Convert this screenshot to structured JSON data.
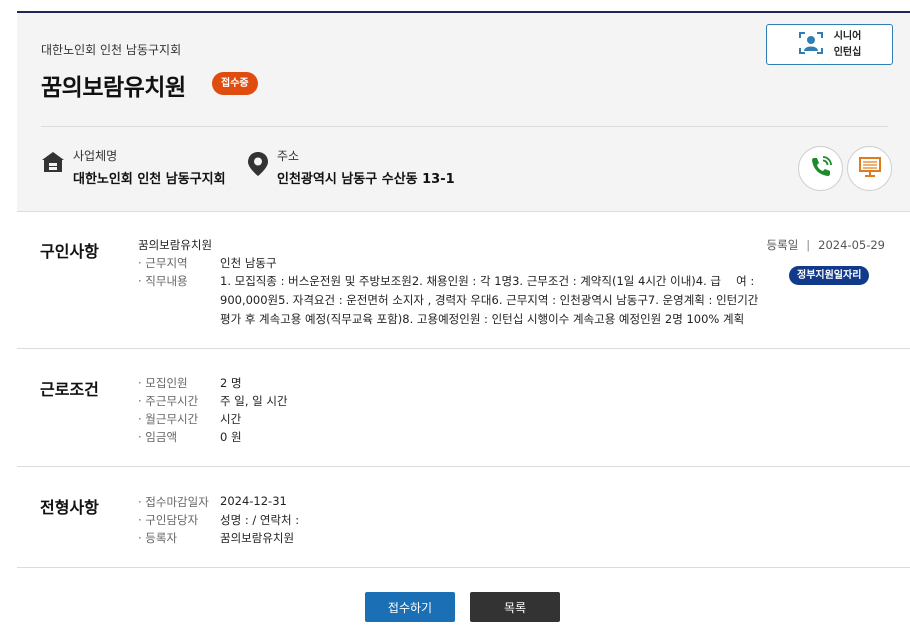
{
  "header": {
    "org_sub": "대한노인회 인천 남동구지회",
    "title": "꿈의보람유치원",
    "status_badge": "접수중",
    "senior_button": {
      "line1": "시니어",
      "line2": "인턴십"
    },
    "business": {
      "label": "사업체명",
      "value": "대한노인회 인천 남동구지회",
      "icon": "building-icon"
    },
    "address": {
      "label": "주소",
      "value": "인천광역시 남동구 수산동 13-1",
      "icon": "location-pin-icon"
    },
    "actions": [
      {
        "name": "phone-icon",
        "color": "#1e8a2e"
      },
      {
        "name": "monitor-icon",
        "color": "#e07b1a"
      }
    ]
  },
  "recruit": {
    "title": "구인사항",
    "post_name": "꿈의보람유치원",
    "reg_label": "등록일",
    "reg_sep": "|",
    "reg_date": "2024-05-29",
    "badge": "정부지원일자리",
    "rows": [
      {
        "key": "· 근무지역",
        "value": "인천 남동구"
      },
      {
        "key": "· 직무내용",
        "value": ""
      }
    ],
    "duty_lines": [
      "1. 모집직종 : 버스운전원 및 주방보조원2. 채용인원 : 각 1명3. 근무조건 : 계약직(1일 4시간 이내)4. 급　 여 :",
      "900,000원5. 자격요건 : 운전면허 소지자 , 경력자 우대6. 근무지역 : 인천광역시 남동구7. 운영계획 : 인턴기간",
      "평가 후 계속고용 예정(직무교육 포함)8. 고용예정인원 : 인턴십 시행이수 계속고용 예정인원 2명 100% 계획"
    ]
  },
  "conditions": {
    "title": "근로조건",
    "rows": [
      {
        "key": "· 모집인원",
        "value": "2 명"
      },
      {
        "key": "· 주근무시간",
        "value": "주 일, 일 시간"
      },
      {
        "key": "· 월근무시간",
        "value": "시간"
      },
      {
        "key": "· 임금액",
        "value": "0 원"
      }
    ]
  },
  "selection": {
    "title": "전형사항",
    "rows": [
      {
        "key": "· 접수마감일자",
        "value": "2024-12-31"
      },
      {
        "key": "· 구인담당자",
        "value": "성명 : / 연락처 :"
      },
      {
        "key": "· 등록자",
        "value": "꿈의보람유치원"
      }
    ]
  },
  "buttons": {
    "apply": "접수하기",
    "list": "목록"
  },
  "colors": {
    "accent": "#1a6fb5",
    "status": "#e04b0f",
    "gov_badge": "#123a8a",
    "header_border": "#1e2a55"
  }
}
